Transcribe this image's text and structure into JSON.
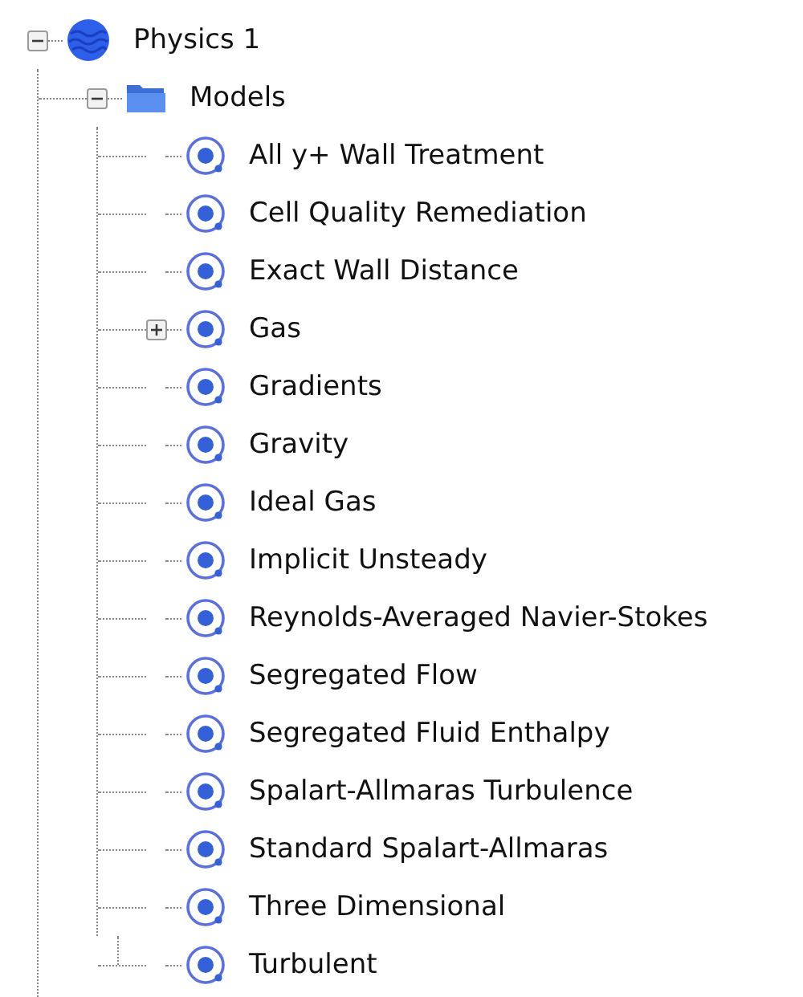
{
  "tree": [
    {
      "label": "Physics 1",
      "kind": "physics",
      "expanded": true,
      "children": [
        {
          "label": "Models",
          "kind": "folder",
          "expanded": true,
          "children": [
            {
              "label": "All y+ Wall Treatment",
              "kind": "model"
            },
            {
              "label": "Cell Quality Remediation",
              "kind": "model"
            },
            {
              "label": "Exact Wall Distance",
              "kind": "model"
            },
            {
              "label": "Gas",
              "kind": "model",
              "expanded": false
            },
            {
              "label": "Gradients",
              "kind": "model"
            },
            {
              "label": "Gravity",
              "kind": "model"
            },
            {
              "label": "Ideal Gas",
              "kind": "model"
            },
            {
              "label": "Implicit Unsteady",
              "kind": "model"
            },
            {
              "label": "Reynolds-Averaged Navier-Stokes",
              "kind": "model"
            },
            {
              "label": "Segregated Flow",
              "kind": "model"
            },
            {
              "label": "Segregated Fluid Enthalpy",
              "kind": "model"
            },
            {
              "label": "Spalart-Allmaras Turbulence",
              "kind": "model"
            },
            {
              "label": "Standard Spalart-Allmaras",
              "kind": "model"
            },
            {
              "label": "Three Dimensional",
              "kind": "model"
            },
            {
              "label": "Turbulent",
              "kind": "model"
            }
          ]
        }
      ]
    }
  ]
}
